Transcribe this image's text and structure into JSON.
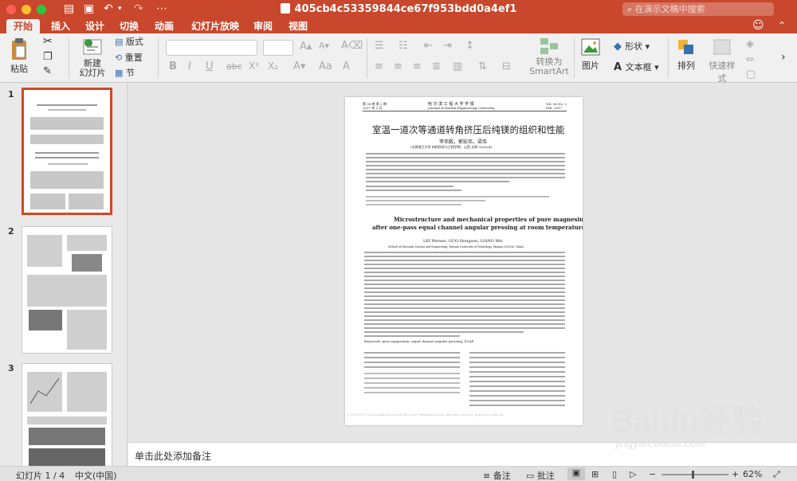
{
  "window": {
    "title": "405cb4c53359844ce67f953bdd0a4ef1",
    "search_placeholder": "在演示文稿中搜索"
  },
  "ribbon_tabs": [
    {
      "label": "开始",
      "active": true
    },
    {
      "label": "插入"
    },
    {
      "label": "设计"
    },
    {
      "label": "切换"
    },
    {
      "label": "动画"
    },
    {
      "label": "幻灯片放映"
    },
    {
      "label": "审阅"
    },
    {
      "label": "视图"
    }
  ],
  "toolbar": {
    "paste": "粘贴",
    "new_slide": "新建\n幻灯片",
    "layout": "版式",
    "reset": "重置",
    "section": "节",
    "convert_smartart": "转换为\nSmartArt",
    "picture": "图片",
    "shape": "形状",
    "textbox": "文本框",
    "arrange": "排列",
    "quick_styles": "快速样式"
  },
  "slides": [
    {
      "number": "1"
    },
    {
      "number": "2"
    },
    {
      "number": "3"
    }
  ],
  "paper": {
    "header_left": "第 36 卷 第 2 期",
    "header_left_2": "2017 年 2 月",
    "header_center": "哈 尔 滨 工 程 大 学 学 报",
    "header_center_2": "Journal of Harbin Engineering University",
    "header_right": "Vol. 36 No. 2",
    "header_right_2": "Feb. 2017",
    "title_cn": "室温一道次等通道转角挤压后纯镁的组织和性能",
    "authors_cn": "李伟毅，郭宏伟，梁伟",
    "affil_cn": "(太原理工大学 材料科学与工程学院，山西 太原 030024)",
    "title_en_1": "Microstructure and mechanical properties of pure magnesium",
    "title_en_2": "after one-pass equal channel angular pressing at room temperature",
    "authors_en": "LEI Weiwei,  GUO Hongwei,  LIANG Wei",
    "affil_en": "(School of Materials Science and Engineering, Taiyuan University of Technology, Taiyuan 030024, China)",
    "keywords_en": "Keywords: pure magnesium;  equal channel angular pressing;  ECAP",
    "footer": "© 1994-2019 China Academic Journal Electronic Publishing House. All rights reserved.   http://www.cnki.net"
  },
  "notes_placeholder": "单击此处添加备注",
  "status": {
    "slide_info": "幻灯片 1 / 4",
    "language": "中文(中国)",
    "notes": "备注",
    "comments": "批注",
    "zoom": "62%"
  },
  "watermark": {
    "brand": "Baidu经验",
    "url": "jingyan.baidu.com"
  }
}
